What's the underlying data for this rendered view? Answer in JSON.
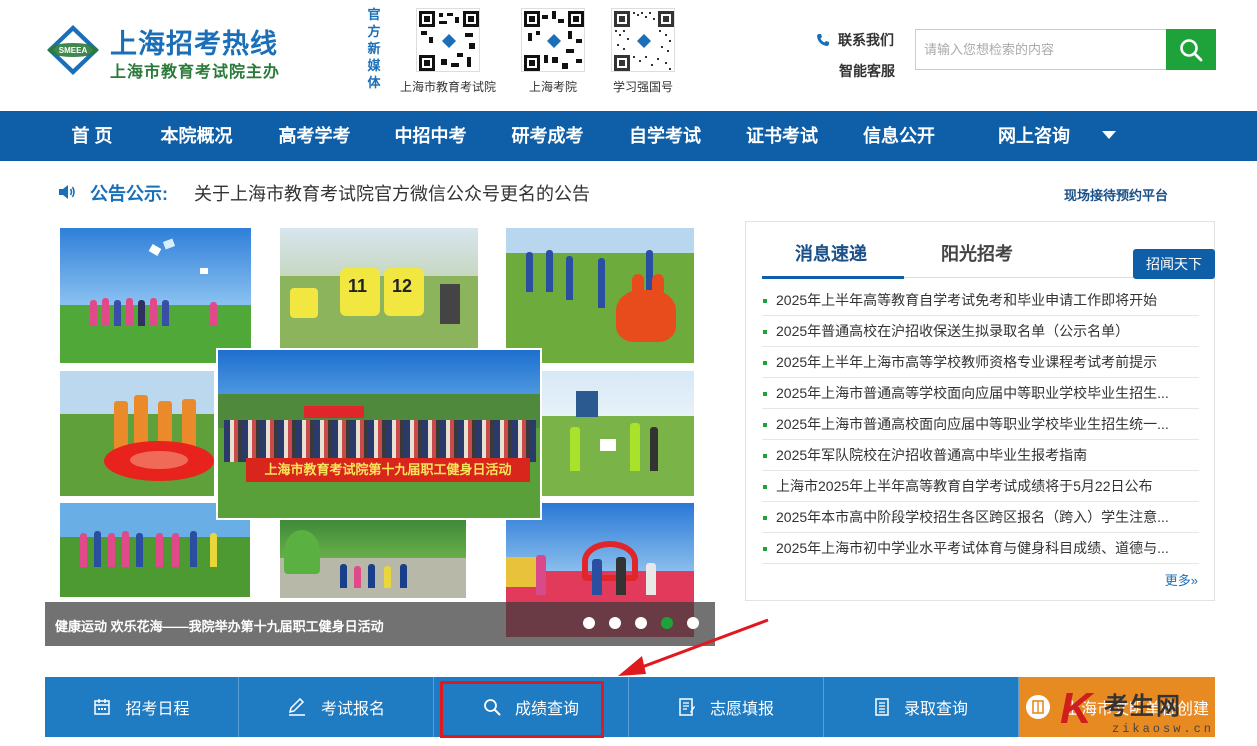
{
  "header": {
    "site_title": "上海招考热线",
    "site_subtitle": "上海市教育考试院主办",
    "emblem_text": "SMEEA",
    "media_label": "官方新媒体",
    "qr_codes": [
      {
        "caption": "上海市教育考试院"
      },
      {
        "caption": "上海考院"
      },
      {
        "caption": "学习强国号"
      }
    ],
    "contact_label": "联系我们",
    "service_label": "智能客服",
    "search_placeholder": "请输入您想检索的内容"
  },
  "nav": {
    "items": [
      "首 页",
      "本院概况",
      "高考学考",
      "中招中考",
      "研考成考",
      "自学考试",
      "证书考试",
      "信息公开",
      "网上咨询"
    ]
  },
  "notice": {
    "label": "公告公示:",
    "text": "关于上海市教育考试院官方微信公众号更名的公告",
    "platform_link": "现场接待预约平台"
  },
  "slider": {
    "banner_text": "上海市教育考试院第十九届职工健身日活动",
    "bib_numbers": [
      "11",
      "12"
    ],
    "caption": "健康运动 欢乐花海——我院举办第十九届职工健身日活动",
    "dot_count": 5,
    "active_dot": 4
  },
  "news": {
    "tabs": [
      "消息速递",
      "阳光招考"
    ],
    "button": "招闻天下",
    "items": [
      "2025年上半年高等教育自学考试免考和毕业申请工作即将开始",
      "2025年普通高校在沪招收保送生拟录取名单（公示名单）",
      "2025年上半年上海市高等学校教师资格专业课程考试考前提示",
      "2025年上海市普通高等学校面向应届中等职业学校毕业生招生...",
      "2025年上海市普通高校面向应届中等职业学校毕业生招生统一...",
      "2025年军队院校在沪招收普通高中毕业生报考指南",
      "上海市2025年上半年高等教育自学考试成绩将于5月22日公布",
      "2025年本市高中阶段学校招生各区跨区报名（跨入）学生注意...",
      "2025年上海市初中学业水平考试体育与健身科目成绩、道德与..."
    ],
    "more": "更多»"
  },
  "quickbar": {
    "items": [
      {
        "label": "招考日程",
        "icon": "calendar-icon"
      },
      {
        "label": "考试报名",
        "icon": "pencil-icon"
      },
      {
        "label": "成绩查询",
        "icon": "search-icon"
      },
      {
        "label": "志愿填报",
        "icon": "form-icon"
      },
      {
        "label": "录取查询",
        "icon": "document-icon"
      },
      {
        "label": "上海市文明单位创建",
        "icon": "book-icon"
      }
    ]
  },
  "watermark": {
    "letter": "K",
    "name": "考生网",
    "url": "zikaosw.cn"
  },
  "colors": {
    "brand_blue": "#0e5fa8",
    "accent_green": "#1ea33a",
    "quickbar_blue": "#1f7bc2",
    "highlight_red": "#e0191f",
    "orange": "#e88a22"
  }
}
